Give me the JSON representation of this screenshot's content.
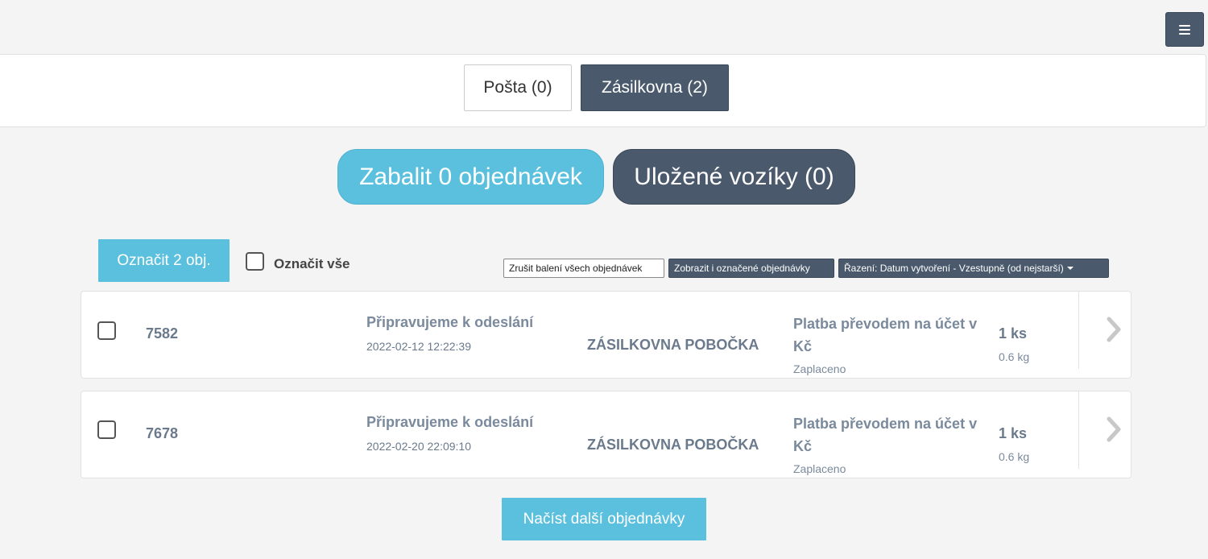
{
  "header": {
    "menu_icon": "hamburger-icon"
  },
  "carriers": [
    {
      "label": "Pošta (0)",
      "active": false
    },
    {
      "label": "Zásilkovna (2)",
      "active": true
    }
  ],
  "actions": {
    "pack_label": "Zabalit 0 objednávek",
    "saved_carts_label": "Uložené vozíky (0)"
  },
  "toolbar": {
    "mark_label": "Označit 2 obj.",
    "select_all_label": "Označit vše",
    "cancel_label": "Zrušit balení všech objednávek",
    "show_marked_label": "Zobrazit i označené objednávky",
    "sort_label": "Řazení: Datum vytvoření - Vzestupně (od nejstarší)"
  },
  "orders": [
    {
      "id": "7582",
      "status": "Připravujeme k odeslání",
      "date": "2022-02-12 12:22:39",
      "shipping": "ZÁSILKOVNA POBOČKA",
      "payment": "Platba převodem na účet v Kč",
      "payment_status": "Zaplaceno",
      "quantity": "1 ks",
      "weight": "0.6 kg"
    },
    {
      "id": "7678",
      "status": "Připravujeme k odeslání",
      "date": "2022-02-20 22:09:10",
      "shipping": "ZÁSILKOVNA POBOČKA",
      "payment": "Platba převodem na účet v Kč",
      "payment_status": "Zaplaceno",
      "quantity": "1 ks",
      "weight": "0.6 kg"
    }
  ],
  "footer": {
    "load_more_label": "Načíst další objednávky"
  },
  "colors": {
    "dark": "#4a5a6c",
    "accent": "#5bc0de",
    "text_muted": "#6a7a8c"
  }
}
